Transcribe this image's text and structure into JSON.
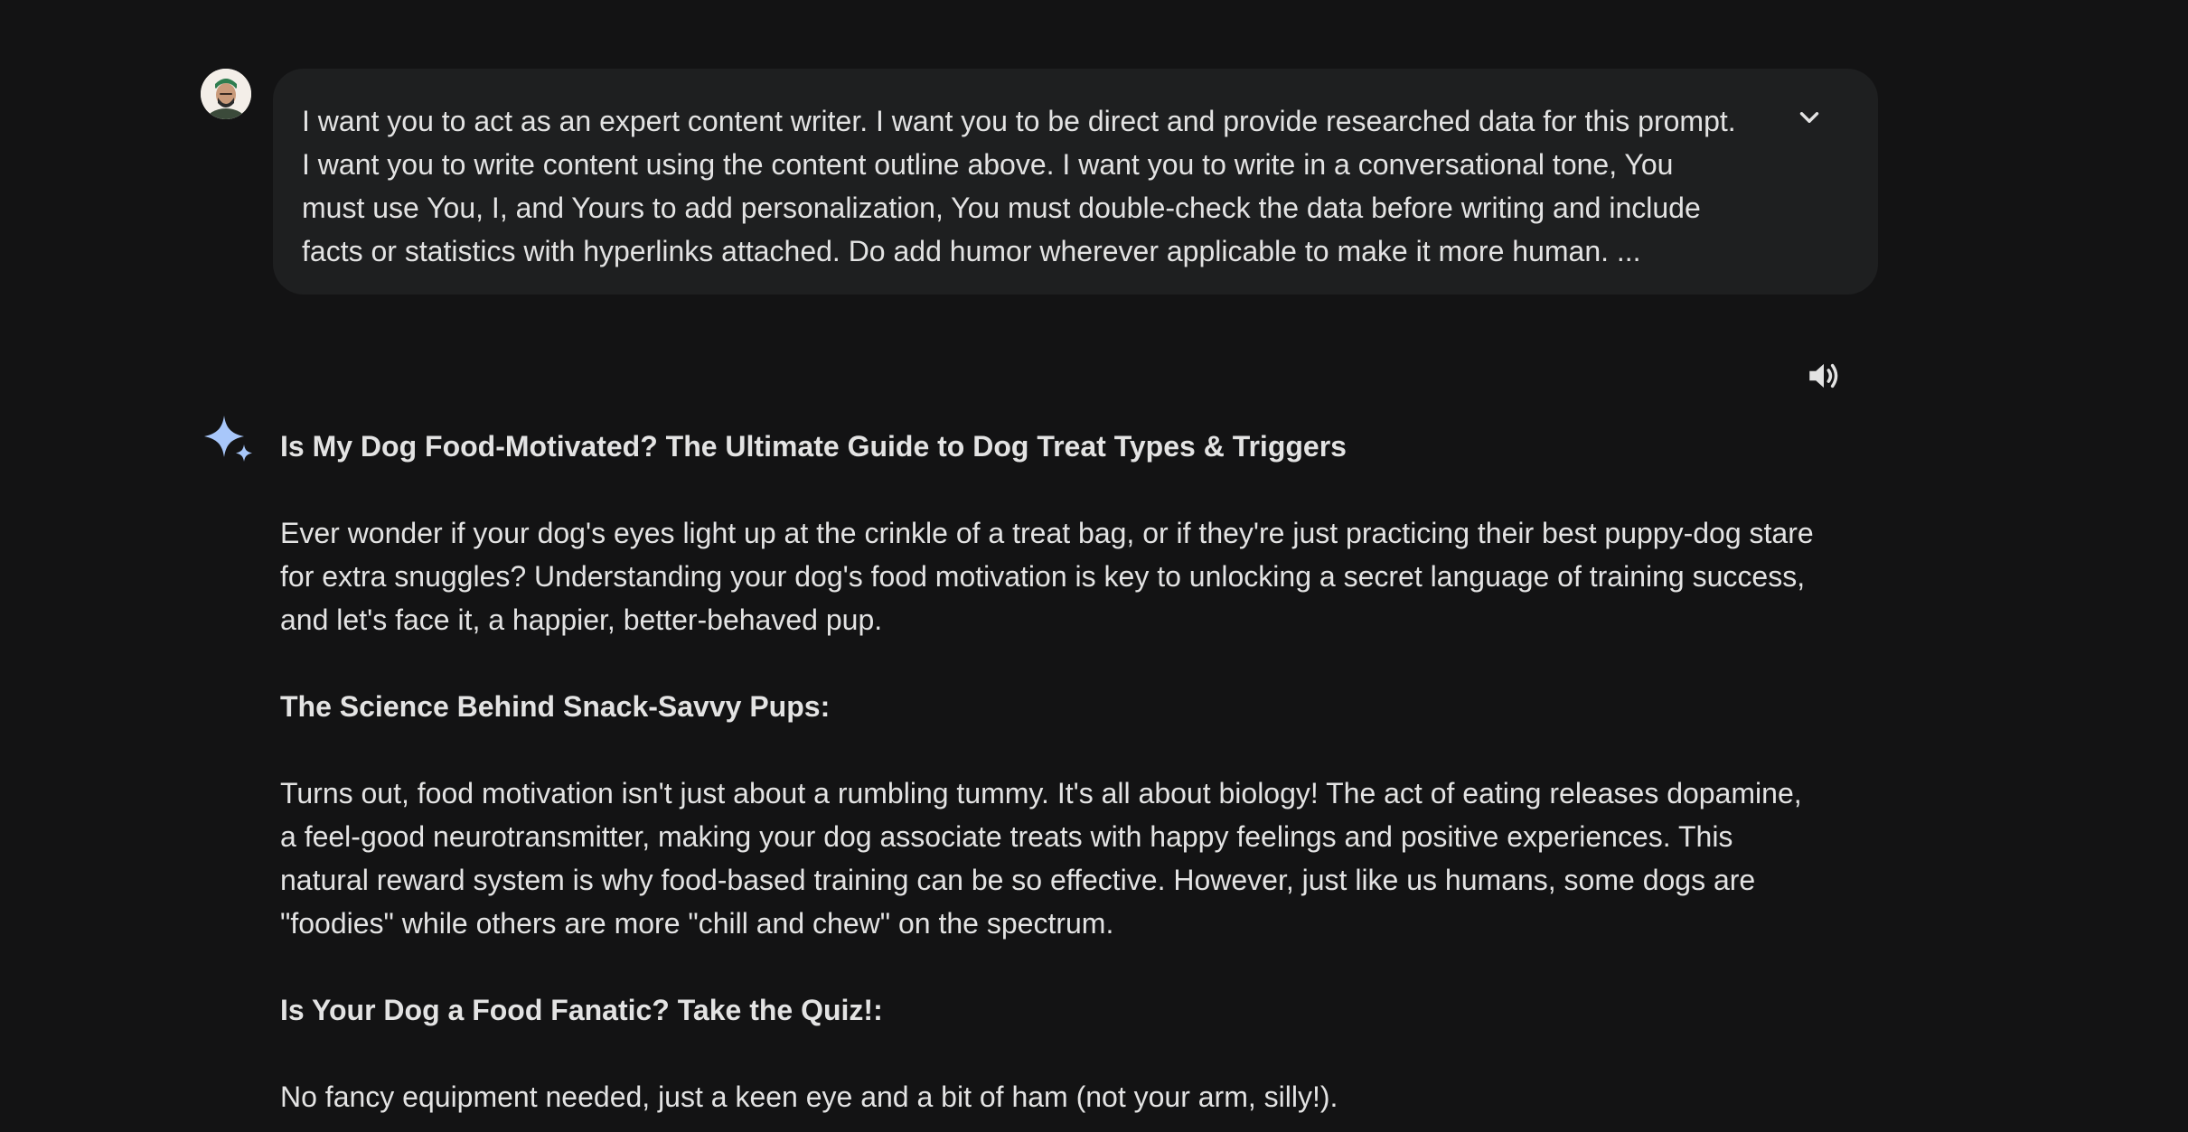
{
  "user_prompt": {
    "avatar_icon": "user-avatar",
    "text": "I want you to act as an expert content writer. I want you to be direct and provide researched data for this prompt. I want you to write content using the content outline above. I want you to write in a conversational tone, You must use You, I, and Yours to add personalization, You must double-check the data before writing and include facts or statistics with hyperlinks attached. Do add humor wherever applicable to make it more human. ...",
    "expand_icon": "chevron-down-icon"
  },
  "response": {
    "speaker_icon": "volume-icon",
    "model_icon": "gemini-sparkle-icon",
    "accent_color": "#a8c7fa",
    "title": "Is My Dog Food-Motivated? The Ultimate Guide to Dog Treat Types & Triggers",
    "intro": "Ever wonder if your dog's eyes light up at the crinkle of a treat bag, or if they're just practicing their best puppy-dog stare for extra snuggles? Understanding your dog's food motivation is key to unlocking a secret language of training success, and let's face it, a happier, better-behaved pup.",
    "section1_heading": "The Science Behind Snack-Savvy Pups:",
    "section1_body": "Turns out, food motivation isn't just about a rumbling tummy. It's all about biology! The act of eating releases dopamine, a feel-good neurotransmitter, making your dog associate treats with happy feelings and positive experiences. This natural reward system is why food-based training can be so effective. However, just like us humans, some dogs are \"foodies\" while others are more \"chill and chew\" on the spectrum.",
    "section2_heading": "Is Your Dog a Food Fanatic? Take the Quiz!:",
    "section2_body": "No fancy equipment needed, just a keen eye and a bit of ham (not your arm, silly!)."
  }
}
